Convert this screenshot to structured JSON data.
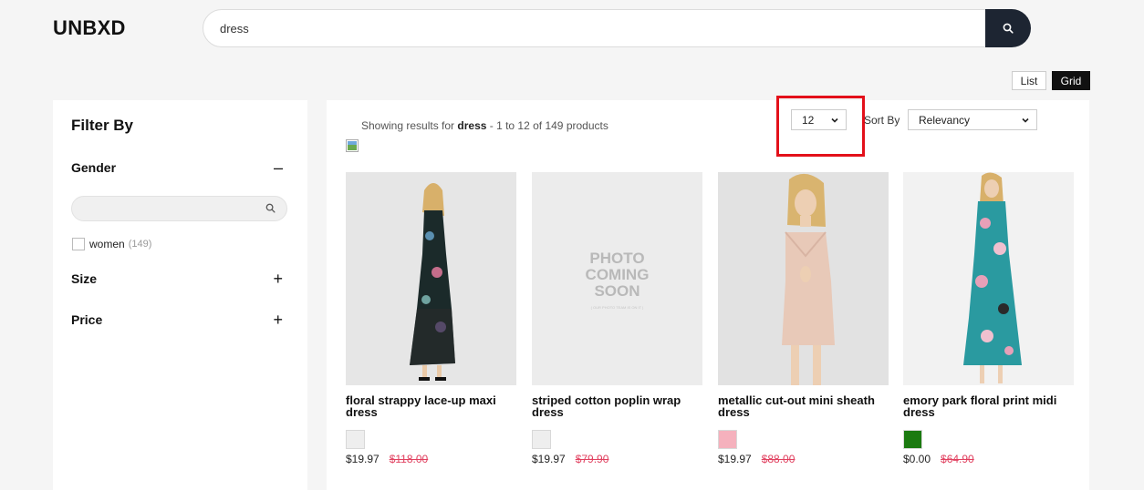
{
  "header": {
    "logo": "UNBXD",
    "search_value": "dress"
  },
  "view": {
    "list_label": "List",
    "grid_label": "Grid"
  },
  "sidebar": {
    "title": "Filter By",
    "facets": [
      {
        "label": "Gender",
        "toggle": "–"
      },
      {
        "label": "Size",
        "toggle": "+"
      },
      {
        "label": "Price",
        "toggle": "+"
      }
    ],
    "gender_option": {
      "label": "women",
      "count": "(149)"
    }
  },
  "results": {
    "summary_prefix": "Showing results for ",
    "query": "dress",
    "summary_suffix": " - 1 to 12 of 149 products",
    "per_page": "12",
    "sort_label": "Sort By",
    "sort_value": "Relevancy"
  },
  "products": [
    {
      "title": "floral strappy lace-up maxi dress",
      "price": "$19.97",
      "old_price": "$118.00",
      "swatch": "#eeeeee"
    },
    {
      "title": "striped cotton poplin wrap dress",
      "price": "$19.97",
      "old_price": "$79.90",
      "swatch": "#eeeeee"
    },
    {
      "title": "metallic cut-out mini sheath dress",
      "price": "$19.97",
      "old_price": "$88.00",
      "swatch": "#f5b1bd"
    },
    {
      "title": "emory park floral print midi dress",
      "price": "$0.00",
      "old_price": "$64.90",
      "swatch": "#1b7a10"
    }
  ],
  "placeholder": {
    "line1": "PHOTO",
    "line2": "COMING",
    "line3": "SOON",
    "small": "( OUR PHOTO TEAM IS ON IT )"
  },
  "colors": {
    "accent_dark": "#1d2532",
    "sale_red": "#e1405f",
    "highlight": "#e3101a"
  }
}
